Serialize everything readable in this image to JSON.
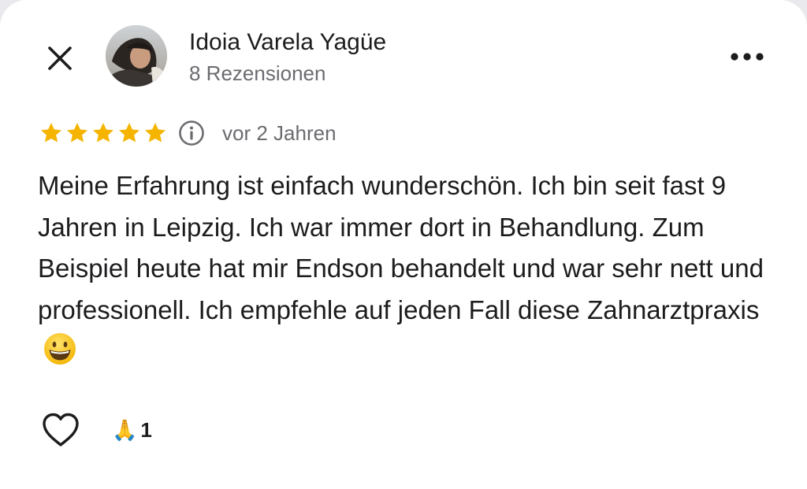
{
  "reviewer": {
    "name": "Idoia Varela Yagüe",
    "review_count": "8 Rezensionen",
    "avatar_icon": "avatar-photo"
  },
  "header": {
    "close_icon": "close-icon",
    "more_icon": "more-horizontal-icon"
  },
  "rating": {
    "stars": 5,
    "max_stars": 5,
    "star_color": "#f5b400",
    "info_icon": "info-icon",
    "date": "vor 2 Jahren"
  },
  "review": {
    "text": "Meine Erfahrung ist einfach wunderschön. Ich bin seit fast 9 Jahren in Leipzig. Ich war immer dort in Behandlung. Zum Beispiel heute hat mir Endson behandelt und war sehr nett und professionell. Ich empfehle auf jeden Fall diese Zahnarztpraxis",
    "trailing_emoji": "grinning-face-emoji"
  },
  "actions": {
    "like_icon": "heart-outline-icon",
    "reaction_emoji": "🙏",
    "reaction_count": "1"
  }
}
